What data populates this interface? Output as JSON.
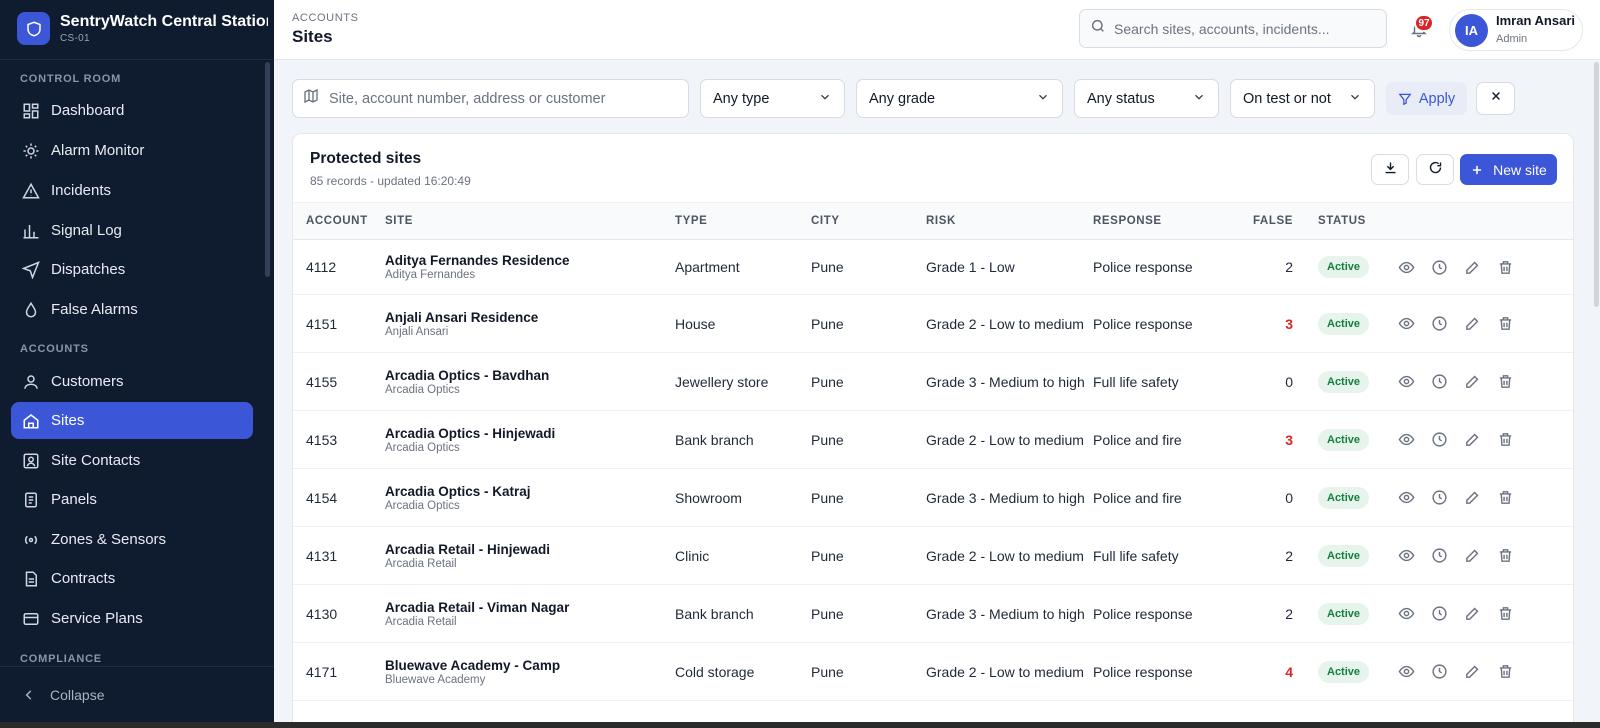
{
  "brand": {
    "title": "SentryWatch Central Station",
    "subtitle": "CS-01"
  },
  "sidebar": {
    "sections": [
      "CONTROL ROOM",
      "ACCOUNTS",
      "COMPLIANCE"
    ],
    "items": [
      {
        "label": "Dashboard",
        "icon": "dashboard-icon"
      },
      {
        "label": "Alarm Monitor",
        "icon": "alarm-icon"
      },
      {
        "label": "Incidents",
        "icon": "warning-icon"
      },
      {
        "label": "Signal Log",
        "icon": "bar-chart-icon"
      },
      {
        "label": "Dispatches",
        "icon": "send-icon"
      },
      {
        "label": "False Alarms",
        "icon": "drop-icon"
      },
      {
        "label": "Customers",
        "icon": "user-icon"
      },
      {
        "label": "Sites",
        "icon": "home-icon",
        "active": true
      },
      {
        "label": "Site Contacts",
        "icon": "contact-icon"
      },
      {
        "label": "Panels",
        "icon": "document-icon"
      },
      {
        "label": "Zones & Sensors",
        "icon": "sensor-icon"
      },
      {
        "label": "Contracts",
        "icon": "contract-icon"
      },
      {
        "label": "Service Plans",
        "icon": "card-icon"
      }
    ],
    "collapse_label": "Collapse"
  },
  "header": {
    "breadcrumb": "ACCOUNTS",
    "title": "Sites",
    "search_placeholder": "Search sites, accounts, incidents...",
    "notification_count": "97",
    "user": {
      "initials": "IA",
      "name": "Imran Ansari",
      "role": "Admin"
    }
  },
  "filters": {
    "search_placeholder": "Site, account number, address or customer",
    "type": "Any type",
    "grade": "Any grade",
    "status": "Any status",
    "test": "On test or not",
    "apply_label": "Apply"
  },
  "table": {
    "title": "Protected sites",
    "subtitle": "85 records - updated 16:20:49",
    "new_label": "New site",
    "columns": [
      "ACCOUNT",
      "SITE",
      "TYPE",
      "CITY",
      "RISK",
      "RESPONSE",
      "FALSE",
      "STATUS"
    ],
    "rows": [
      {
        "account": "4112",
        "site": "Aditya Fernandes Residence",
        "owner": "Aditya Fernandes",
        "type": "Apartment",
        "city": "Pune",
        "risk": "Grade 1 - Low",
        "response": "Police response",
        "false": "2",
        "status": "Active"
      },
      {
        "account": "4151",
        "site": "Anjali Ansari Residence",
        "owner": "Anjali Ansari",
        "type": "House",
        "city": "Pune",
        "risk": "Grade 2 - Low to medium",
        "response": "Police response",
        "false": "3",
        "status": "Active"
      },
      {
        "account": "4155",
        "site": "Arcadia Optics - Bavdhan",
        "owner": "Arcadia Optics",
        "type": "Jewellery store",
        "city": "Pune",
        "risk": "Grade 3 - Medium to high",
        "response": "Full life safety",
        "false": "0",
        "status": "Active"
      },
      {
        "account": "4153",
        "site": "Arcadia Optics - Hinjewadi",
        "owner": "Arcadia Optics",
        "type": "Bank branch",
        "city": "Pune",
        "risk": "Grade 2 - Low to medium",
        "response": "Police and fire",
        "false": "3",
        "status": "Active"
      },
      {
        "account": "4154",
        "site": "Arcadia Optics - Katraj",
        "owner": "Arcadia Optics",
        "type": "Showroom",
        "city": "Pune",
        "risk": "Grade 3 - Medium to high",
        "response": "Police and fire",
        "false": "0",
        "status": "Active"
      },
      {
        "account": "4131",
        "site": "Arcadia Retail - Hinjewadi",
        "owner": "Arcadia Retail",
        "type": "Clinic",
        "city": "Pune",
        "risk": "Grade 2 - Low to medium",
        "response": "Full life safety",
        "false": "2",
        "status": "Active"
      },
      {
        "account": "4130",
        "site": "Arcadia Retail - Viman Nagar",
        "owner": "Arcadia Retail",
        "type": "Bank branch",
        "city": "Pune",
        "risk": "Grade 3 - Medium to high",
        "response": "Police response",
        "false": "2",
        "status": "Active"
      },
      {
        "account": "4171",
        "site": "Bluewave Academy - Camp",
        "owner": "Bluewave Academy",
        "type": "Cold storage",
        "city": "Pune",
        "risk": "Grade 2 - Low to medium",
        "response": "Police response",
        "false": "4",
        "status": "Active"
      }
    ]
  },
  "colors": {
    "sidebar_bg": "#0f1b2e",
    "accent": "#3b56d6",
    "danger": "#dc2626",
    "success": "#15803d"
  }
}
